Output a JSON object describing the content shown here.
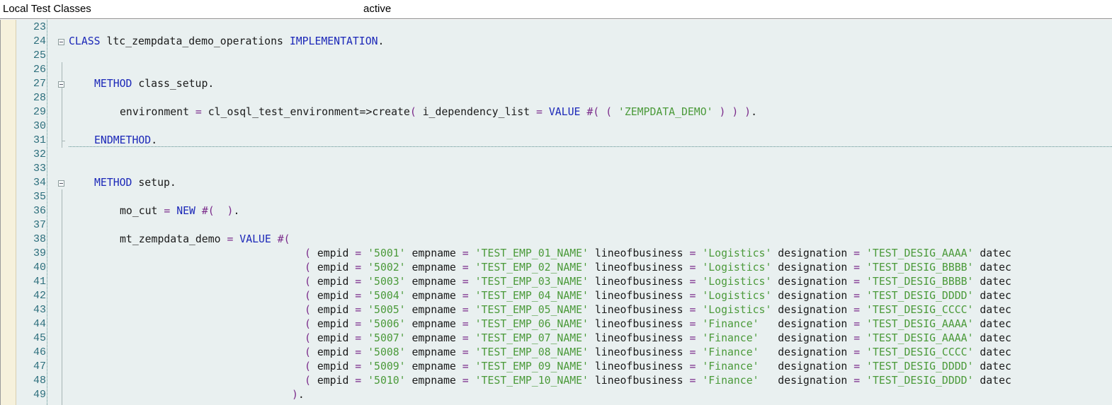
{
  "header": {
    "title": "Local Test Classes",
    "status": "active"
  },
  "editor": {
    "lines": [
      {
        "n": "23",
        "indent": 0,
        "tokens": []
      },
      {
        "n": "24",
        "indent": 0,
        "fold": true,
        "tokens": [
          [
            "kw",
            "CLASS"
          ],
          [
            "t",
            " ltc_zempdata_demo_operations "
          ],
          [
            "kw",
            "IMPLEMENTATION"
          ],
          [
            "t",
            "."
          ]
        ]
      },
      {
        "n": "25",
        "indent": 0,
        "tokens": []
      },
      {
        "n": "26",
        "indent": 0,
        "tokens": []
      },
      {
        "n": "27",
        "indent": 4,
        "fold": true,
        "tokens": [
          [
            "kw",
            "METHOD"
          ],
          [
            "t",
            " class_setup."
          ]
        ]
      },
      {
        "n": "28",
        "indent": 0,
        "tokens": []
      },
      {
        "n": "29",
        "indent": 8,
        "tokens": [
          [
            "t",
            "environment "
          ],
          [
            "op",
            "="
          ],
          [
            "t",
            " cl_osql_test_environment=>create"
          ],
          [
            "op",
            "("
          ],
          [
            "t",
            " i_dependency_list "
          ],
          [
            "op",
            "="
          ],
          [
            "t",
            " "
          ],
          [
            "kw",
            "VALUE"
          ],
          [
            "t",
            " "
          ],
          [
            "op",
            "#("
          ],
          [
            "t",
            " "
          ],
          [
            "op",
            "("
          ],
          [
            "t",
            " "
          ],
          [
            "str",
            "'ZEMPDATA_DEMO'"
          ],
          [
            "t",
            " "
          ],
          [
            "op",
            ")"
          ],
          [
            "t",
            " "
          ],
          [
            "op",
            ")"
          ],
          [
            "t",
            " "
          ],
          [
            "op",
            ")"
          ],
          [
            "t",
            "."
          ]
        ]
      },
      {
        "n": "30",
        "indent": 0,
        "tokens": []
      },
      {
        "n": "31",
        "indent": 4,
        "foldEnd": true,
        "tokens": [
          [
            "kw",
            "ENDMETHOD"
          ],
          [
            "t",
            "."
          ]
        ]
      },
      {
        "n": "32",
        "indent": 0,
        "tokens": []
      },
      {
        "n": "33",
        "indent": 0,
        "tokens": []
      },
      {
        "n": "34",
        "indent": 4,
        "fold": true,
        "tokens": [
          [
            "kw",
            "METHOD"
          ],
          [
            "t",
            " setup."
          ]
        ]
      },
      {
        "n": "35",
        "indent": 0,
        "tokens": []
      },
      {
        "n": "36",
        "indent": 8,
        "tokens": [
          [
            "t",
            "mo_cut "
          ],
          [
            "op",
            "="
          ],
          [
            "t",
            " "
          ],
          [
            "kw",
            "NEW"
          ],
          [
            "t",
            " "
          ],
          [
            "op",
            "#("
          ],
          [
            "t",
            "  "
          ],
          [
            "op",
            ")"
          ],
          [
            "t",
            "."
          ]
        ]
      },
      {
        "n": "37",
        "indent": 0,
        "tokens": []
      },
      {
        "n": "38",
        "indent": 8,
        "tokens": [
          [
            "t",
            "mt_zempdata_demo "
          ],
          [
            "op",
            "="
          ],
          [
            "t",
            " "
          ],
          [
            "kw",
            "VALUE"
          ],
          [
            "t",
            " "
          ],
          [
            "op",
            "#("
          ]
        ]
      },
      {
        "n": "39",
        "indent": 37,
        "tokens": [
          [
            "op",
            "("
          ],
          [
            "t",
            " empid "
          ],
          [
            "op",
            "="
          ],
          [
            "t",
            " "
          ],
          [
            "str",
            "'5001'"
          ],
          [
            "t",
            " empname "
          ],
          [
            "op",
            "="
          ],
          [
            "t",
            " "
          ],
          [
            "str",
            "'TEST_EMP_01_NAME'"
          ],
          [
            "t",
            " lineofbusiness "
          ],
          [
            "op",
            "="
          ],
          [
            "t",
            " "
          ],
          [
            "str",
            "'Logistics'"
          ],
          [
            "t",
            " designation "
          ],
          [
            "op",
            "="
          ],
          [
            "t",
            " "
          ],
          [
            "str",
            "'TEST_DESIG_AAAA'"
          ],
          [
            "t",
            " datec"
          ]
        ]
      },
      {
        "n": "40",
        "indent": 37,
        "tokens": [
          [
            "op",
            "("
          ],
          [
            "t",
            " empid "
          ],
          [
            "op",
            "="
          ],
          [
            "t",
            " "
          ],
          [
            "str",
            "'5002'"
          ],
          [
            "t",
            " empname "
          ],
          [
            "op",
            "="
          ],
          [
            "t",
            " "
          ],
          [
            "str",
            "'TEST_EMP_02_NAME'"
          ],
          [
            "t",
            " lineofbusiness "
          ],
          [
            "op",
            "="
          ],
          [
            "t",
            " "
          ],
          [
            "str",
            "'Logistics'"
          ],
          [
            "t",
            " designation "
          ],
          [
            "op",
            "="
          ],
          [
            "t",
            " "
          ],
          [
            "str",
            "'TEST_DESIG_BBBB'"
          ],
          [
            "t",
            " datec"
          ]
        ]
      },
      {
        "n": "41",
        "indent": 37,
        "tokens": [
          [
            "op",
            "("
          ],
          [
            "t",
            " empid "
          ],
          [
            "op",
            "="
          ],
          [
            "t",
            " "
          ],
          [
            "str",
            "'5003'"
          ],
          [
            "t",
            " empname "
          ],
          [
            "op",
            "="
          ],
          [
            "t",
            " "
          ],
          [
            "str",
            "'TEST_EMP_03_NAME'"
          ],
          [
            "t",
            " lineofbusiness "
          ],
          [
            "op",
            "="
          ],
          [
            "t",
            " "
          ],
          [
            "str",
            "'Logistics'"
          ],
          [
            "t",
            " designation "
          ],
          [
            "op",
            "="
          ],
          [
            "t",
            " "
          ],
          [
            "str",
            "'TEST_DESIG_BBBB'"
          ],
          [
            "t",
            " datec"
          ]
        ]
      },
      {
        "n": "42",
        "indent": 37,
        "tokens": [
          [
            "op",
            "("
          ],
          [
            "t",
            " empid "
          ],
          [
            "op",
            "="
          ],
          [
            "t",
            " "
          ],
          [
            "str",
            "'5004'"
          ],
          [
            "t",
            " empname "
          ],
          [
            "op",
            "="
          ],
          [
            "t",
            " "
          ],
          [
            "str",
            "'TEST_EMP_04_NAME'"
          ],
          [
            "t",
            " lineofbusiness "
          ],
          [
            "op",
            "="
          ],
          [
            "t",
            " "
          ],
          [
            "str",
            "'Logistics'"
          ],
          [
            "t",
            " designation "
          ],
          [
            "op",
            "="
          ],
          [
            "t",
            " "
          ],
          [
            "str",
            "'TEST_DESIG_DDDD'"
          ],
          [
            "t",
            " datec"
          ]
        ]
      },
      {
        "n": "43",
        "indent": 37,
        "tokens": [
          [
            "op",
            "("
          ],
          [
            "t",
            " empid "
          ],
          [
            "op",
            "="
          ],
          [
            "t",
            " "
          ],
          [
            "str",
            "'5005'"
          ],
          [
            "t",
            " empname "
          ],
          [
            "op",
            "="
          ],
          [
            "t",
            " "
          ],
          [
            "str",
            "'TEST_EMP_05_NAME'"
          ],
          [
            "t",
            " lineofbusiness "
          ],
          [
            "op",
            "="
          ],
          [
            "t",
            " "
          ],
          [
            "str",
            "'Logistics'"
          ],
          [
            "t",
            " designation "
          ],
          [
            "op",
            "="
          ],
          [
            "t",
            " "
          ],
          [
            "str",
            "'TEST_DESIG_CCCC'"
          ],
          [
            "t",
            " datec"
          ]
        ]
      },
      {
        "n": "44",
        "indent": 37,
        "tokens": [
          [
            "op",
            "("
          ],
          [
            "t",
            " empid "
          ],
          [
            "op",
            "="
          ],
          [
            "t",
            " "
          ],
          [
            "str",
            "'5006'"
          ],
          [
            "t",
            " empname "
          ],
          [
            "op",
            "="
          ],
          [
            "t",
            " "
          ],
          [
            "str",
            "'TEST_EMP_06_NAME'"
          ],
          [
            "t",
            " lineofbusiness "
          ],
          [
            "op",
            "="
          ],
          [
            "t",
            " "
          ],
          [
            "str",
            "'Finance'"
          ],
          [
            "t",
            "   designation "
          ],
          [
            "op",
            "="
          ],
          [
            "t",
            " "
          ],
          [
            "str",
            "'TEST_DESIG_AAAA'"
          ],
          [
            "t",
            " datec"
          ]
        ]
      },
      {
        "n": "45",
        "indent": 37,
        "tokens": [
          [
            "op",
            "("
          ],
          [
            "t",
            " empid "
          ],
          [
            "op",
            "="
          ],
          [
            "t",
            " "
          ],
          [
            "str",
            "'5007'"
          ],
          [
            "t",
            " empname "
          ],
          [
            "op",
            "="
          ],
          [
            "t",
            " "
          ],
          [
            "str",
            "'TEST_EMP_07_NAME'"
          ],
          [
            "t",
            " lineofbusiness "
          ],
          [
            "op",
            "="
          ],
          [
            "t",
            " "
          ],
          [
            "str",
            "'Finance'"
          ],
          [
            "t",
            "   designation "
          ],
          [
            "op",
            "="
          ],
          [
            "t",
            " "
          ],
          [
            "str",
            "'TEST_DESIG_AAAA'"
          ],
          [
            "t",
            " datec"
          ]
        ]
      },
      {
        "n": "46",
        "indent": 37,
        "tokens": [
          [
            "op",
            "("
          ],
          [
            "t",
            " empid "
          ],
          [
            "op",
            "="
          ],
          [
            "t",
            " "
          ],
          [
            "str",
            "'5008'"
          ],
          [
            "t",
            " empname "
          ],
          [
            "op",
            "="
          ],
          [
            "t",
            " "
          ],
          [
            "str",
            "'TEST_EMP_08_NAME'"
          ],
          [
            "t",
            " lineofbusiness "
          ],
          [
            "op",
            "="
          ],
          [
            "t",
            " "
          ],
          [
            "str",
            "'Finance'"
          ],
          [
            "t",
            "   designation "
          ],
          [
            "op",
            "="
          ],
          [
            "t",
            " "
          ],
          [
            "str",
            "'TEST_DESIG_CCCC'"
          ],
          [
            "t",
            " datec"
          ]
        ]
      },
      {
        "n": "47",
        "indent": 37,
        "tokens": [
          [
            "op",
            "("
          ],
          [
            "t",
            " empid "
          ],
          [
            "op",
            "="
          ],
          [
            "t",
            " "
          ],
          [
            "str",
            "'5009'"
          ],
          [
            "t",
            " empname "
          ],
          [
            "op",
            "="
          ],
          [
            "t",
            " "
          ],
          [
            "str",
            "'TEST_EMP_09_NAME'"
          ],
          [
            "t",
            " lineofbusiness "
          ],
          [
            "op",
            "="
          ],
          [
            "t",
            " "
          ],
          [
            "str",
            "'Finance'"
          ],
          [
            "t",
            "   designation "
          ],
          [
            "op",
            "="
          ],
          [
            "t",
            " "
          ],
          [
            "str",
            "'TEST_DESIG_DDDD'"
          ],
          [
            "t",
            " datec"
          ]
        ]
      },
      {
        "n": "48",
        "indent": 37,
        "tokens": [
          [
            "op",
            "("
          ],
          [
            "t",
            " empid "
          ],
          [
            "op",
            "="
          ],
          [
            "t",
            " "
          ],
          [
            "str",
            "'5010'"
          ],
          [
            "t",
            " empname "
          ],
          [
            "op",
            "="
          ],
          [
            "t",
            " "
          ],
          [
            "str",
            "'TEST_EMP_10_NAME'"
          ],
          [
            "t",
            " lineofbusiness "
          ],
          [
            "op",
            "="
          ],
          [
            "t",
            " "
          ],
          [
            "str",
            "'Finance'"
          ],
          [
            "t",
            "   designation "
          ],
          [
            "op",
            "="
          ],
          [
            "t",
            " "
          ],
          [
            "str",
            "'TEST_DESIG_DDDD'"
          ],
          [
            "t",
            " datec"
          ]
        ]
      },
      {
        "n": "49",
        "indent": 35,
        "tokens": [
          [
            "op",
            ")"
          ],
          [
            "t",
            "."
          ]
        ]
      }
    ]
  },
  "colors": {
    "keyword": "#1c28b8",
    "string": "#4b9a3a",
    "operator": "#7a2a8a",
    "text": "#1a1a1a",
    "line_number": "#2c6e7c",
    "background": "#e9f0f0",
    "breakpoint_gutter": "#f6f1dc"
  }
}
